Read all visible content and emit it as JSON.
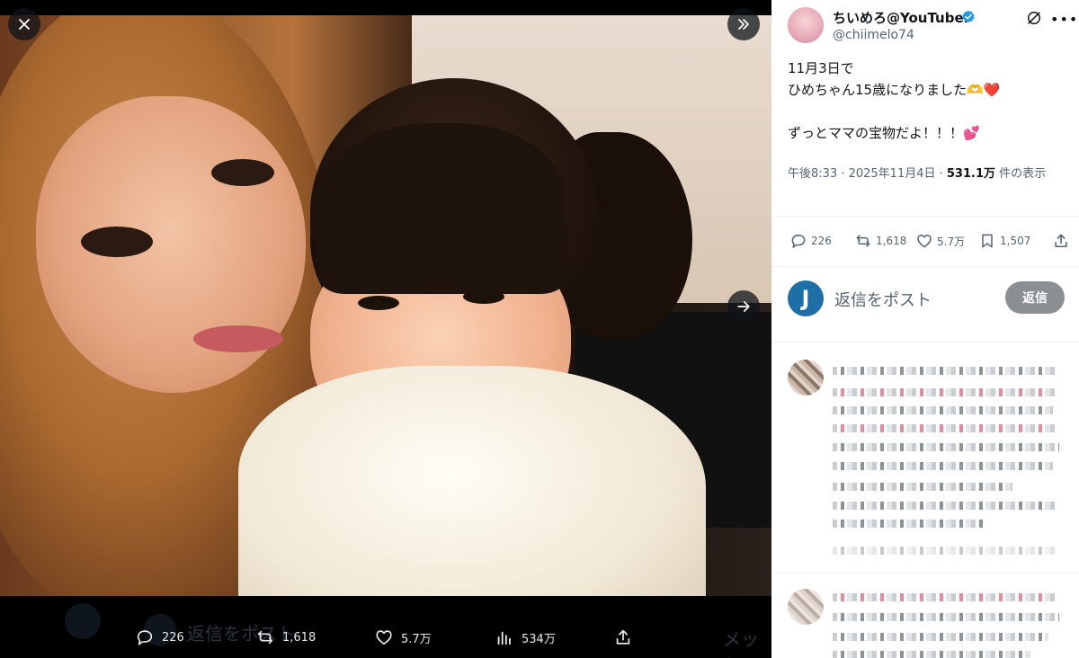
{
  "viewer": {
    "close_icon": "close-icon",
    "expand_icon": "double-chevron-right-icon",
    "next_icon": "arrow-right-icon"
  },
  "media_actions": {
    "replies": "226",
    "reposts": "1,618",
    "likes": "5.7万",
    "views": "534万",
    "ghost_reply_text": "返信をポスト",
    "ghost_message_text": "メッセ"
  },
  "post": {
    "author_name": "ちいめろ@YouTuber",
    "author_handle": "@chiimelo74",
    "lines": [
      "11月3日で",
      "ひめちゃん15歳になりました🫶❤️",
      "",
      "ずっとママの宝物だよ！！！💕"
    ],
    "meta_time": "午後8:33 · 2025年11月4日 · ",
    "meta_views": "531.1万",
    "meta_views_suffix": " 件の表示"
  },
  "stats": {
    "replies": "226",
    "reposts": "1,618",
    "likes": "5.7万",
    "bookmarks": "1,507"
  },
  "reply_box": {
    "avatar_letter": "J",
    "placeholder": "返信をポスト",
    "button_label": "返信"
  },
  "colors": {
    "verified": "#1d9bf0",
    "text_primary": "#0f1419",
    "text_secondary": "#536471",
    "reply_button": "#8a8f94"
  }
}
